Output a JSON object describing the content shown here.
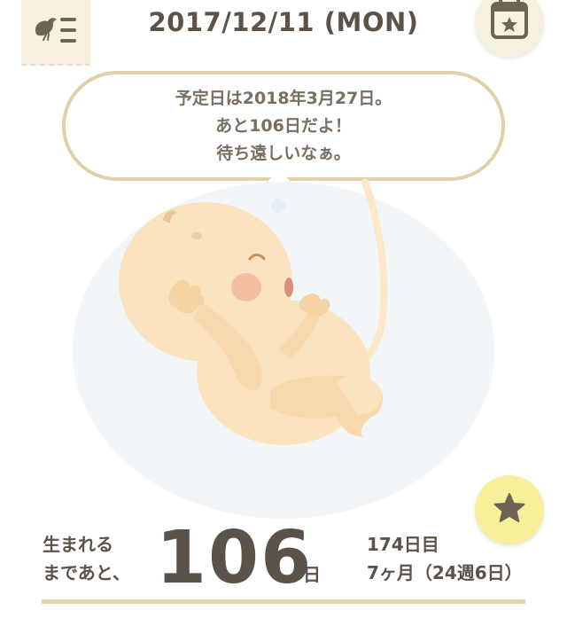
{
  "header": {
    "date": "2017/12/11 (MON)",
    "menu_icon": "bird-menu-icon",
    "calendar_icon": "calendar-star-icon"
  },
  "bubble": {
    "lines": [
      "予定日は2018年3月27日。",
      "あと106日だよ！",
      "待ち遠しいなぁ。"
    ]
  },
  "favorite": {
    "icon": "star-icon"
  },
  "countdown": {
    "label_line1": "生まれる",
    "label_line2": "まであと、",
    "days": "106",
    "unit": "日",
    "detail_line1": "174日目",
    "detail_line2": "7ヶ月（24週6日）"
  },
  "colors": {
    "text": "#5b5349",
    "bubble_border": "#dfd1a8",
    "star_button": "#f8ef9b",
    "header_button": "#f6f0e1"
  }
}
